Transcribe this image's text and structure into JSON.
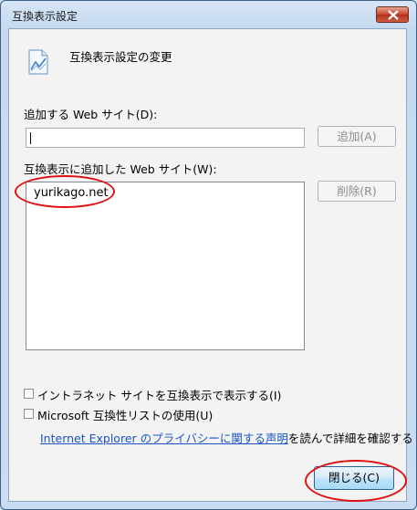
{
  "window": {
    "title": "互換表示設定"
  },
  "header": {
    "text": "互換表示設定の変更"
  },
  "add_site": {
    "label": "追加する Web サイト(D):",
    "value": "",
    "button": "追加(A)"
  },
  "sites": {
    "label": "互換表示に追加した Web サイト(W):",
    "items": [
      "yurikago.net"
    ],
    "remove_button": "削除(R)"
  },
  "options": [
    {
      "label": "イントラネット サイトを互換表示で表示する(I)",
      "checked": false
    },
    {
      "label": "Microsoft 互換性リストの使用(U)",
      "checked": false
    }
  ],
  "privacy": {
    "link": "Internet Explorer のプライバシーに関する声明",
    "suffix": "を読んで詳細を確認する"
  },
  "footer": {
    "close_button": "閉じる(C)"
  },
  "colors": {
    "annotation": "#e01010",
    "link": "#1a54c4"
  }
}
